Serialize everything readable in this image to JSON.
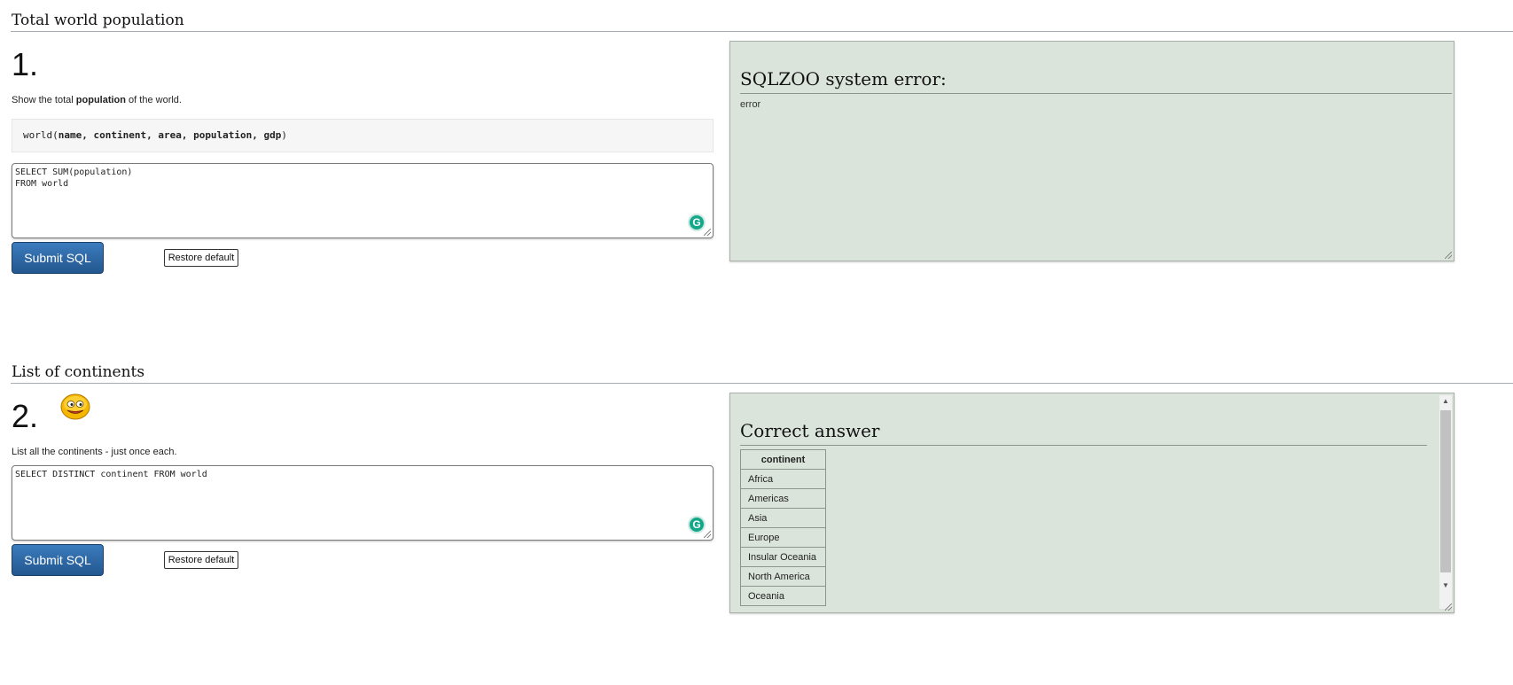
{
  "q1": {
    "section_title": "Total world population",
    "number": "1.",
    "prompt_before": "Show the total ",
    "prompt_bold": "population",
    "prompt_after": " of the world.",
    "schema_table": "world",
    "schema_columns": "name, continent, area, population, gdp",
    "sql": "SELECT SUM(population)\nFROM world",
    "submit_label": "Submit SQL",
    "restore_label": "Restore default",
    "result_heading": "SQLZOO system error:",
    "result_text": "error"
  },
  "q2": {
    "section_title": "List of continents",
    "number": "2.",
    "prompt": "List all the continents - just once each.",
    "sql": "SELECT DISTINCT continent FROM world",
    "submit_label": "Submit SQL",
    "restore_label": "Restore default",
    "result_heading": "Correct answer",
    "table_header": "continent",
    "rows": [
      "Africa",
      "Americas",
      "Asia",
      "Europe",
      "Insular Oceania",
      "North America",
      "Oceania"
    ]
  },
  "icons": {
    "grammarly": "grammarly-icon",
    "smiley": "smiley-face-icon"
  }
}
